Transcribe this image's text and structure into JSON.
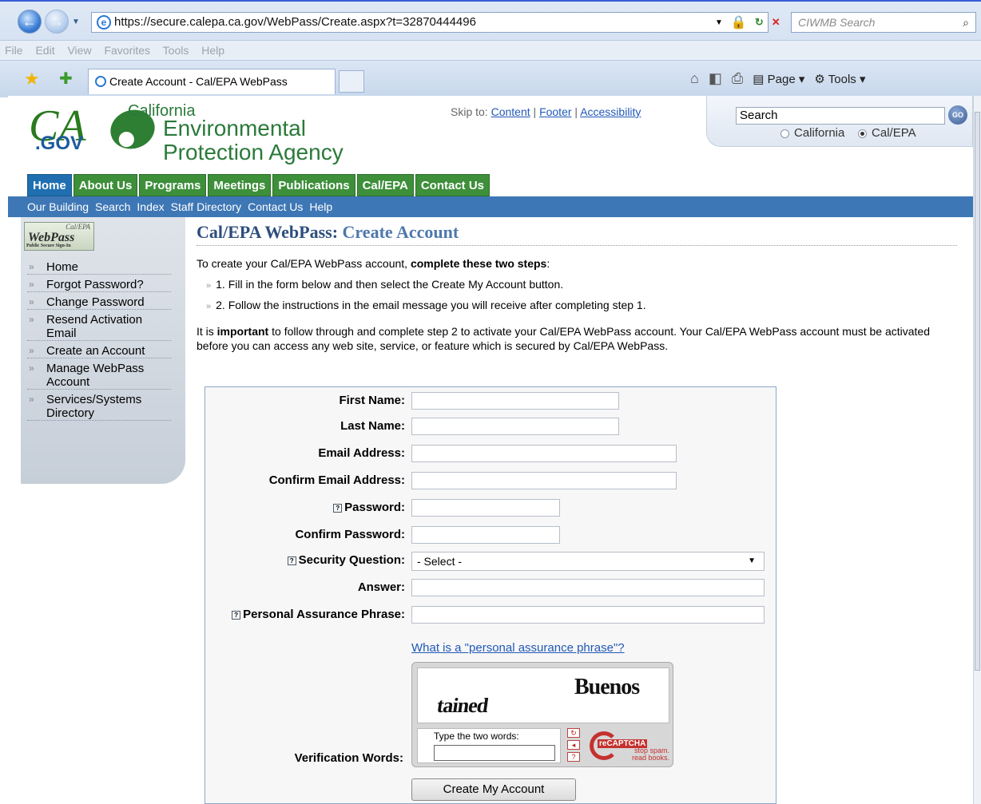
{
  "browser": {
    "url": "https://secure.calepa.ca.gov/WebPass/Create.aspx?t=32870444496",
    "search_placeholder": "CIWMB Search",
    "menu": [
      "File",
      "Edit",
      "View",
      "Favorites",
      "Tools",
      "Help"
    ],
    "tab_title": "Create Account - Cal/EPA WebPass",
    "cmd_page": "Page",
    "cmd_tools": "Tools"
  },
  "header": {
    "logo_ca": "CA",
    "logo_gov": ".GOV",
    "agency_line1": "California",
    "agency_line2": "Environmental",
    "agency_line3": "Protection Agency",
    "skip_prefix": "Skip to:",
    "skip_content": "Content",
    "skip_footer": "Footer",
    "skip_accessibility": "Accessibility",
    "search_value": "Search",
    "go_label": "GO",
    "radio_california": "California",
    "radio_calepa": "Cal/EPA"
  },
  "main_nav": [
    "Home",
    "About Us",
    "Programs",
    "Meetings",
    "Publications",
    "Cal/EPA",
    "Contact Us"
  ],
  "sub_nav": [
    "Our Building",
    "Search",
    "Index",
    "Staff Directory",
    "Contact Us",
    "Help"
  ],
  "sidebar": {
    "logo_top": "Cal/EPA",
    "logo_main": "WebPass",
    "logo_sub": "Public Secure Sign-In",
    "items": [
      "Home",
      "Forgot Password?",
      "Change Password",
      "Resend Activation Email",
      "Create an Account",
      "Manage WebPass Account",
      "Services/Systems Directory"
    ]
  },
  "content": {
    "title_prefix": "Cal/EPA WebPass:",
    "title_accent": "Create Account",
    "intro_prefix": "To create your Cal/EPA WebPass account,",
    "intro_bold": "complete these two steps",
    "intro_suffix": ":",
    "step1": "1. Fill in the form below and then select the Create My Account button.",
    "step2": "2. Follow the instructions in the email message you will receive after completing step 1.",
    "important_prefix": "It is",
    "important_bold": "important",
    "important_text": "to follow through and complete step 2 to activate your Cal/EPA WebPass account. Your Cal/EPA WebPass account must be activated before you can access any web site, service, or feature which is secured by Cal/EPA WebPass."
  },
  "form": {
    "first_name": "First Name:",
    "last_name": "Last Name:",
    "email": "Email Address:",
    "confirm_email": "Confirm Email Address:",
    "password": "Password:",
    "confirm_password": "Confirm Password:",
    "security_question": "Security Question:",
    "security_select_value": "- Select -",
    "answer": "Answer:",
    "assurance": "Personal Assurance Phrase:",
    "assurance_link": "What is a \"personal assurance phrase\"?",
    "verification": "Verification Words:",
    "captcha_word1": "tained",
    "captcha_word2": "Buenos",
    "captcha_prompt": "Type the two words:",
    "captcha_logo": "reCAPTCHA",
    "captcha_tagline": "stop spam. read books.",
    "submit": "Create My Account"
  }
}
